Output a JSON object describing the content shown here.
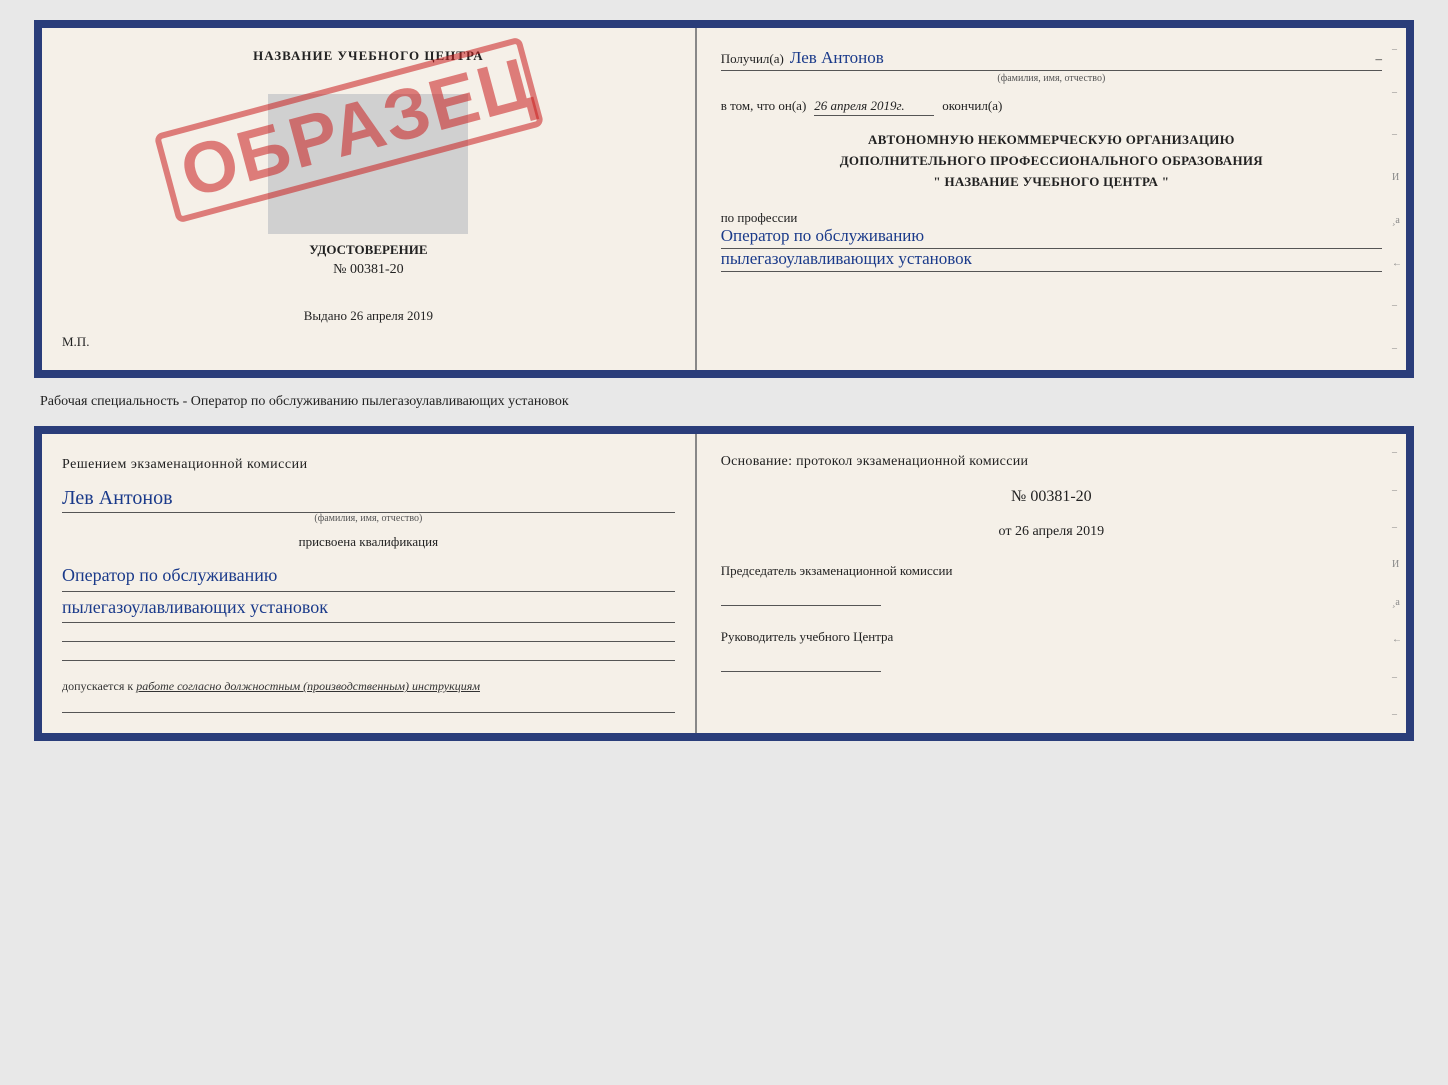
{
  "top_doc": {
    "left": {
      "title": "НАЗВАНИЕ УЧЕБНОГО ЦЕНТРА",
      "stamp": "ОБРАЗЕЦ",
      "udostoverenie": "УДОСТОВЕРЕНИЕ",
      "number": "№ 00381-20",
      "vydano_label": "Выдано",
      "vydano_date": "26 апреля 2019",
      "mp": "М.П."
    },
    "right": {
      "poluchil": "Получил(а)",
      "fio": "Лев Антонов",
      "fio_sub": "(фамилия, имя, отчество)",
      "vtom_label": "в том, что он(а)",
      "vtom_date": "26 апреля 2019г.",
      "okonchil": "окончил(а)",
      "org_line1": "АВТОНОМНУЮ НЕКОММЕРЧЕСКУЮ ОРГАНИЗАЦИЮ",
      "org_line2": "ДОПОЛНИТЕЛЬНОГО ПРОФЕССИОНАЛЬНОГО ОБРАЗОВАНИЯ",
      "org_line3": "\"  НАЗВАНИЕ УЧЕБНОГО ЦЕНТРА  \"",
      "po_professii": "по профессии",
      "profession1": "Оператор по обслуживанию",
      "profession2": "пылегазоулавливающих установок"
    }
  },
  "middle": {
    "label": "Рабочая специальность - Оператор по обслуживанию пылегазоулавливающих установок"
  },
  "bottom_doc": {
    "left": {
      "resheniem": "Решением экзаменационной комиссии",
      "fio": "Лев Антонов",
      "fio_sub": "(фамилия, имя, отчество)",
      "prisvoena": "присвоена квалификация",
      "profession1": "Оператор по обслуживанию",
      "profession2": "пылегазоулавливающих установок",
      "dopuskaetsya_label": "допускается к",
      "dopuskaetsya_val": "работе согласно должностным (производственным) инструкциям"
    },
    "right": {
      "osnov_label": "Основание: протокол экзаменационной комиссии",
      "protocol_number": "№  00381-20",
      "ot_label": "от",
      "ot_date": "26 апреля 2019",
      "predsedatel_label": "Председатель экзаменационной комиссии",
      "rukovoditel_label": "Руководитель учебного Центра"
    }
  },
  "side_marks": [
    "–",
    "–",
    "–",
    "И",
    "¸а",
    "←",
    "–",
    "–",
    "–",
    "–"
  ]
}
